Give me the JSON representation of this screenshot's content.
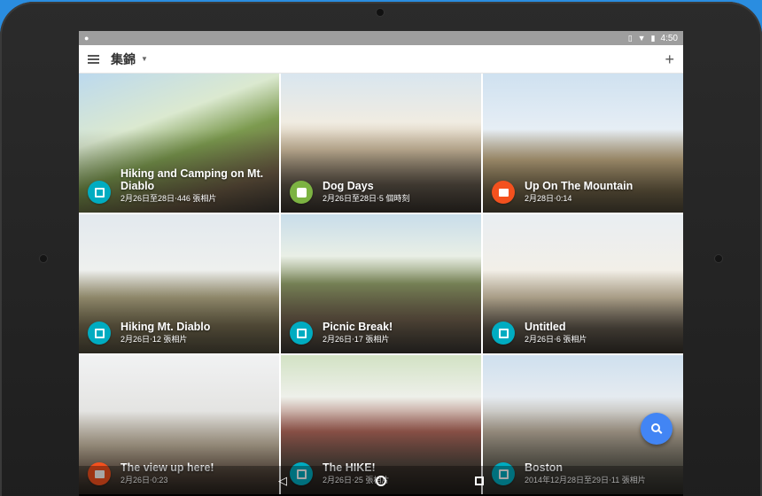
{
  "status_bar": {
    "time": "4:50",
    "left_icon": "location-pin-icon",
    "right_icons": [
      "vibrate-icon",
      "wifi-icon",
      "battery-icon"
    ]
  },
  "app_bar": {
    "title": "集錦",
    "dropdown_icon": "dropdown-arrow-icon",
    "add_icon": "add-icon"
  },
  "albums": [
    {
      "title": "Hiking and Camping on Mt. Diablo",
      "subtitle": "2月26日至28日‧446 張相片",
      "badge_icon": "album-icon",
      "badge_color": "#00acc1"
    },
    {
      "title": "Dog Days",
      "subtitle": "2月26日至28日‧5 個時刻",
      "badge_icon": "story-icon",
      "badge_color": "#7cb342"
    },
    {
      "title": "Up On The Mountain",
      "subtitle": "2月28日‧0:14",
      "badge_icon": "movie-icon",
      "badge_color": "#f4511e"
    },
    {
      "title": "Hiking Mt. Diablo",
      "subtitle": "2月26日‧12 張相片",
      "badge_icon": "album-icon",
      "badge_color": "#00acc1"
    },
    {
      "title": "Picnic Break!",
      "subtitle": "2月26日‧17 張相片",
      "badge_icon": "album-icon",
      "badge_color": "#00acc1"
    },
    {
      "title": "Untitled",
      "subtitle": "2月26日‧6 張相片",
      "badge_icon": "album-icon",
      "badge_color": "#00acc1"
    },
    {
      "title": "The view up here!",
      "subtitle": "2月26日‧0:23",
      "badge_icon": "movie-icon",
      "badge_color": "#f4511e"
    },
    {
      "title": "The HIKE!",
      "subtitle": "2月26日‧25 張相片",
      "badge_icon": "album-icon",
      "badge_color": "#00acc1"
    },
    {
      "title": "Boston",
      "subtitle": "2014年12月28日至29日‧11 張相片",
      "badge_icon": "album-icon",
      "badge_color": "#00acc1"
    }
  ],
  "fab": {
    "icon": "search-icon",
    "color": "#4285f4"
  },
  "nav_bar": {
    "icons": [
      "back-icon",
      "home-icon",
      "recents-icon"
    ]
  },
  "colors": {
    "device_frame": "#1e1e1e",
    "background": "#2a8de0",
    "status_bar": "#9e9e9e"
  }
}
